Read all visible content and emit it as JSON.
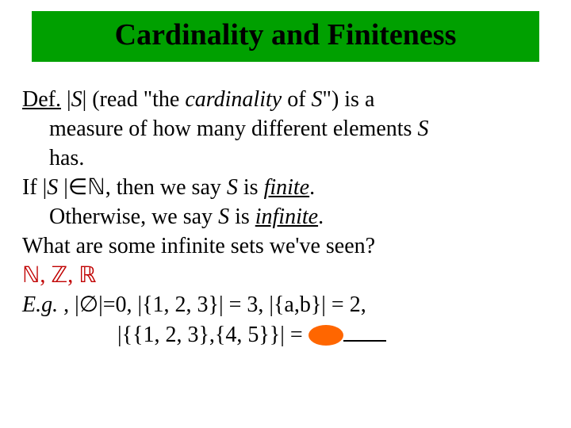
{
  "title": "Cardinality and Finiteness",
  "body": {
    "def_label": "Def.",
    "def_line1a": " |",
    "def_S1": "S",
    "def_line1b": "| (read \"the ",
    "def_card": "cardinality",
    "def_line1c": " of ",
    "def_S2": "S",
    "def_line1d": "\") is a",
    "def_line2a": "measure of how many different elements ",
    "def_S3": "S",
    "def_line3": "has.",
    "if_a": "If |",
    "if_S": "S",
    "if_b": " |∈",
    "natN": "ℕ",
    "if_c": ", then we say ",
    "if_S2": "S",
    "if_d": " is ",
    "finite": "finite",
    "if_e": ".",
    "otherwise_a": "Otherwise, we say ",
    "otherwise_S": "S",
    "otherwise_b": " is ",
    "infinite": "infinite",
    "otherwise_c": ".",
    "question": "What are some infinite sets we've seen?",
    "sets_N": "ℕ",
    "sets_sep1": ", ",
    "sets_Z": "ℤ",
    "sets_sep2": ", ",
    "sets_R": "ℝ",
    "eg_label": "E.g.",
    "eg_a": " , |∅|=0,   |{1, 2, 3}| = 3,   |{a,b}| = 2,",
    "eg_line2a": "|{{1, 2, 3},{4, 5}}| = "
  }
}
